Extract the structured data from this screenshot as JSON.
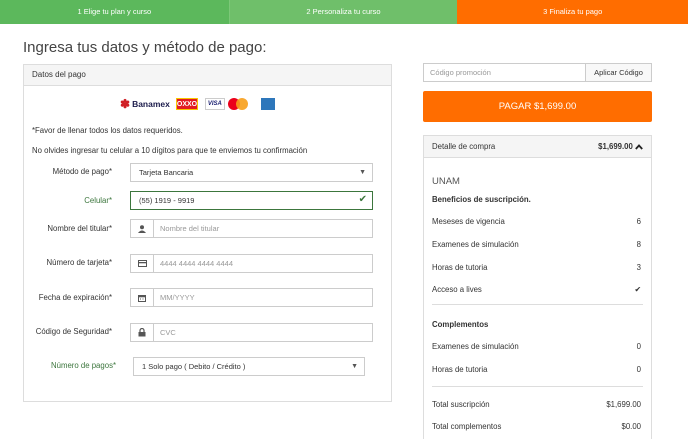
{
  "steps": [
    {
      "label": "1   Elige tu plan y curso"
    },
    {
      "label": "2   Personaliza tu curso"
    },
    {
      "label": "3   Finaliza tu pago"
    }
  ],
  "page_title": "Ingresa tus datos y método de pago:",
  "payment_panel": {
    "title": "Datos del pago",
    "logos": {
      "banamex": "Banamex",
      "oxxo": "OXXO",
      "visa": "VISA",
      "mastercard": "MasterCard",
      "amex": "AMEX"
    },
    "note_required": "*Favor de llenar todos los datos requeridos.",
    "note_phone": "No olvides ingresar tu celular a 10 dígitos para que te enviemos tu confirmación",
    "fields": {
      "method": {
        "label": "Método de pago*",
        "value": "Tarjeta Bancaria"
      },
      "phone": {
        "label": "Celular*",
        "value": "(55) 1919 - 9919"
      },
      "holder": {
        "label": "Nombre del titular*",
        "placeholder": "Nombre del titular",
        "icon": "user-icon"
      },
      "card": {
        "label": "Número de tarjeta*",
        "placeholder": "4444 4444 4444 4444",
        "icon": "credit-card-icon"
      },
      "expiry": {
        "label": "Fecha de expiración*",
        "placeholder": "MM/YYYY",
        "icon": "calendar-icon"
      },
      "cvc": {
        "label": "Código de Seguridad*",
        "placeholder": "CVC",
        "icon": "lock-icon"
      },
      "installments": {
        "label": "Número de pagos*",
        "value": "1 Solo pago ( Debito / Crédito )"
      }
    }
  },
  "promo": {
    "placeholder": "Código promoción",
    "button": "Aplicar Código"
  },
  "pay_button": "PAGAR $1,699.00",
  "detail": {
    "title": "Detalle de compra",
    "amount": "$1,699.00",
    "brand": "UNAM",
    "benefits_title": "Beneficios de suscripción.",
    "benefits": [
      {
        "label": "Meseses de vigencia",
        "value": "6"
      },
      {
        "label": "Examenes de simulación",
        "value": "8"
      },
      {
        "label": "Horas de tutoria",
        "value": "3"
      },
      {
        "label": "Acceso a lives",
        "value": "✔"
      }
    ],
    "complements_title": "Complementos",
    "complements": [
      {
        "label": "Examenes de simulación",
        "value": "0"
      },
      {
        "label": "Horas de tutoria",
        "value": "0"
      }
    ],
    "totals": [
      {
        "label": "Total suscripción",
        "value": "$1,699.00"
      },
      {
        "label": "Total complementos",
        "value": "$0.00"
      }
    ]
  },
  "colors": {
    "green": "#5cb85c",
    "orange": "#ff6d00",
    "success": "#3c763d"
  }
}
